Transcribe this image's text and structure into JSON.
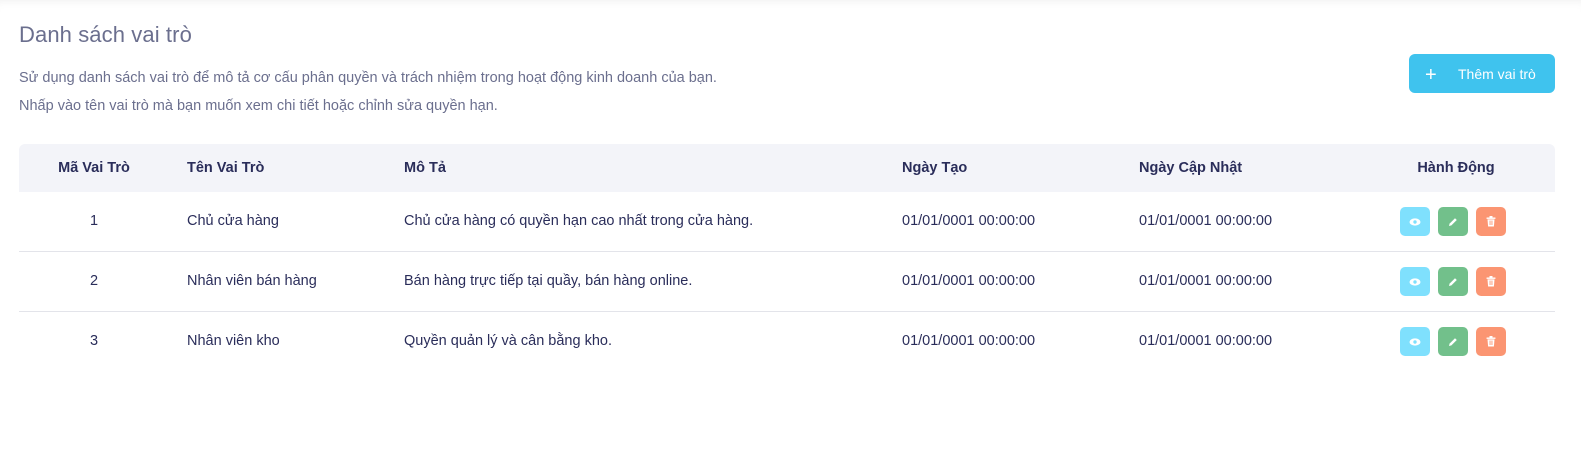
{
  "header": {
    "title": "Danh sách vai trò",
    "description_line1": "Sử dụng danh sách vai trò để mô tả cơ cấu phân quyền và trách nhiệm trong hoạt động kinh doanh của bạn.",
    "description_line2": "Nhấp vào tên vai trò mà bạn muốn xem chi tiết hoặc chỉnh sửa quyền hạn.",
    "add_button": {
      "icon": "plus-icon",
      "label": "Thêm vai trò",
      "color": "#3fc3ee"
    }
  },
  "table": {
    "columns": {
      "id": "Mã Vai Trò",
      "name": "Tên Vai Trò",
      "description": "Mô Tả",
      "created": "Ngày Tạo",
      "updated": "Ngày Cập Nhật",
      "actions": "Hành Động"
    },
    "rows": [
      {
        "id": "1",
        "name": "Chủ cửa hàng",
        "description": "Chủ cửa hàng có quyền hạn cao nhất trong cửa hàng.",
        "created": "01/01/0001 00:00:00",
        "updated": "01/01/0001 00:00:00"
      },
      {
        "id": "2",
        "name": "Nhân viên bán hàng",
        "description": "Bán hàng trực tiếp tại quầy, bán hàng online.",
        "created": "01/01/0001 00:00:00",
        "updated": "01/01/0001 00:00:00"
      },
      {
        "id": "3",
        "name": "Nhân viên kho",
        "description": "Quyền quản lý và cân bằng kho.",
        "created": "01/01/0001 00:00:00",
        "updated": "01/01/0001 00:00:00"
      }
    ],
    "action_icons": {
      "view": {
        "icon": "eye-icon",
        "color": "#7fe0fd"
      },
      "edit": {
        "icon": "pencil-icon",
        "color": "#72c08b"
      },
      "delete": {
        "icon": "trash-icon",
        "color": "#fb9572"
      }
    }
  }
}
